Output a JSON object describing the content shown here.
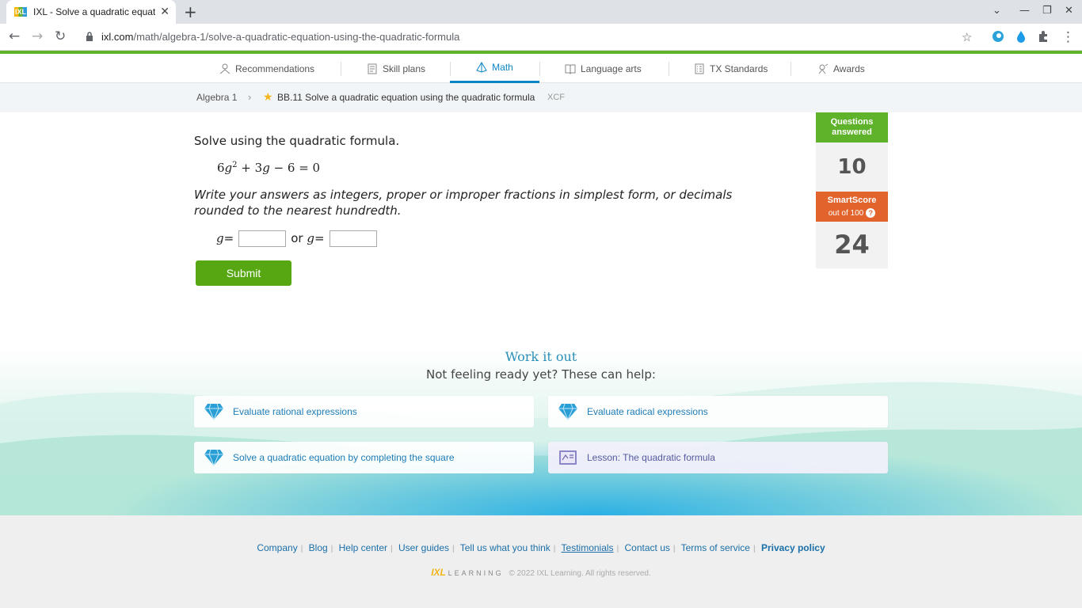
{
  "browser": {
    "tab_title": "IXL - Solve a quadratic equation",
    "favicon_text": "IXL",
    "url_host": "ixl.com",
    "url_path": "/math/algebra-1/solve-a-quadratic-equation-using-the-quadratic-formula"
  },
  "nav": {
    "items": [
      {
        "label": "Recommendations",
        "icon": "recommendations-icon"
      },
      {
        "label": "Skill plans",
        "icon": "skill-plans-icon"
      },
      {
        "label": "Math",
        "icon": "math-icon",
        "active": true
      },
      {
        "label": "Language arts",
        "icon": "book-icon"
      },
      {
        "label": "TX Standards",
        "icon": "standards-icon"
      },
      {
        "label": "Awards",
        "icon": "awards-icon"
      }
    ],
    "accent": "#0b86c4"
  },
  "breadcrumb": {
    "parent": "Algebra 1",
    "skill": "BB.11 Solve a quadratic equation using the quadratic formula",
    "code": "XCF"
  },
  "question": {
    "prompt": "Solve using the quadratic formula.",
    "eq_a": "6",
    "eq_var": "g",
    "eq_exp": "2",
    "eq_mid": " + 3",
    "eq_end": " − 6 = 0",
    "instructions": "Write your answers as integers, proper or improper fractions in simplest form, or decimals rounded to the nearest hundredth.",
    "var": "g",
    "equals": " =",
    "or": "or",
    "answer1": "",
    "answer2": "",
    "submit_label": "Submit"
  },
  "score": {
    "questions_label": "Questions answered",
    "questions_value": "10",
    "smartscore_label": "SmartScore",
    "smartscore_sub": "out of 100",
    "smartscore_help": "?",
    "smartscore_value": "24",
    "colors": {
      "questions": "#5fb32b",
      "smartscore": "#e2642c"
    }
  },
  "work_it_out": {
    "title": "Work it out",
    "subtitle": "Not feeling ready yet? These can help:",
    "cards": [
      {
        "label": "Evaluate rational expressions",
        "icon": "diamond-icon"
      },
      {
        "label": "Evaluate radical expressions",
        "icon": "diamond-icon"
      },
      {
        "label": "Solve a quadratic equation by completing the square",
        "icon": "diamond-icon"
      },
      {
        "label": "Lesson: The quadratic formula",
        "icon": "lesson-icon"
      }
    ]
  },
  "footer": {
    "links": [
      "Company",
      "Blog",
      "Help center",
      "User guides",
      "Tell us what you think",
      "Testimonials",
      "Contact us",
      "Terms of service",
      "Privacy policy"
    ],
    "logo": "IXL",
    "logo_suffix": "LEARNING",
    "copyright": "© 2022 IXL Learning. All rights reserved."
  }
}
